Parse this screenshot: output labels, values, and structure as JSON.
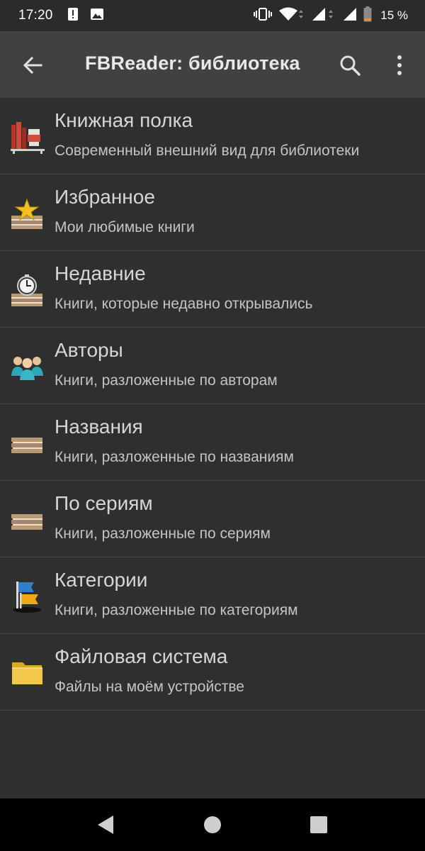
{
  "status_bar": {
    "time": "17:20",
    "battery_percent": "15 %",
    "icons": [
      "alert-icon",
      "image-icon",
      "vibrate-icon",
      "wifi-icon",
      "signal-icon",
      "signal-icon",
      "battery-icon"
    ]
  },
  "app_bar": {
    "title": "FBReader: библиотека",
    "back_icon": "arrow-back-icon",
    "search_icon": "search-icon",
    "menu_icon": "more-vert-icon"
  },
  "items": [
    {
      "title": "Книжная полка",
      "subtitle": "Современный внешний вид для библиотеки",
      "icon": "bookshelf-icon"
    },
    {
      "title": "Избранное",
      "subtitle": "Мои любимые книги",
      "icon": "favorites-star-icon"
    },
    {
      "title": "Недавние",
      "subtitle": "Книги, которые недавно открывались",
      "icon": "recent-clock-icon"
    },
    {
      "title": "Авторы",
      "subtitle": "Книги, разложенные по авторам",
      "icon": "authors-people-icon"
    },
    {
      "title": "Названия",
      "subtitle": "Книги, разложенные по названиям",
      "icon": "books-stack-icon"
    },
    {
      "title": "По сериям",
      "subtitle": "Книги, разложенные по сериям",
      "icon": "books-stack-icon"
    },
    {
      "title": "Категории",
      "subtitle": "Книги, разложенные по категориям",
      "icon": "category-flag-icon"
    },
    {
      "title": "Файловая система",
      "subtitle": "Файлы на моём устройстве",
      "icon": "folder-icon"
    }
  ],
  "nav_bar": {
    "back_icon": "nav-back-icon",
    "home_icon": "nav-home-icon",
    "recents_icon": "nav-recents-icon"
  },
  "colors": {
    "background": "#2f2f2f",
    "app_bar": "#414141",
    "divider": "#474747",
    "nav_bar": "#000000"
  }
}
